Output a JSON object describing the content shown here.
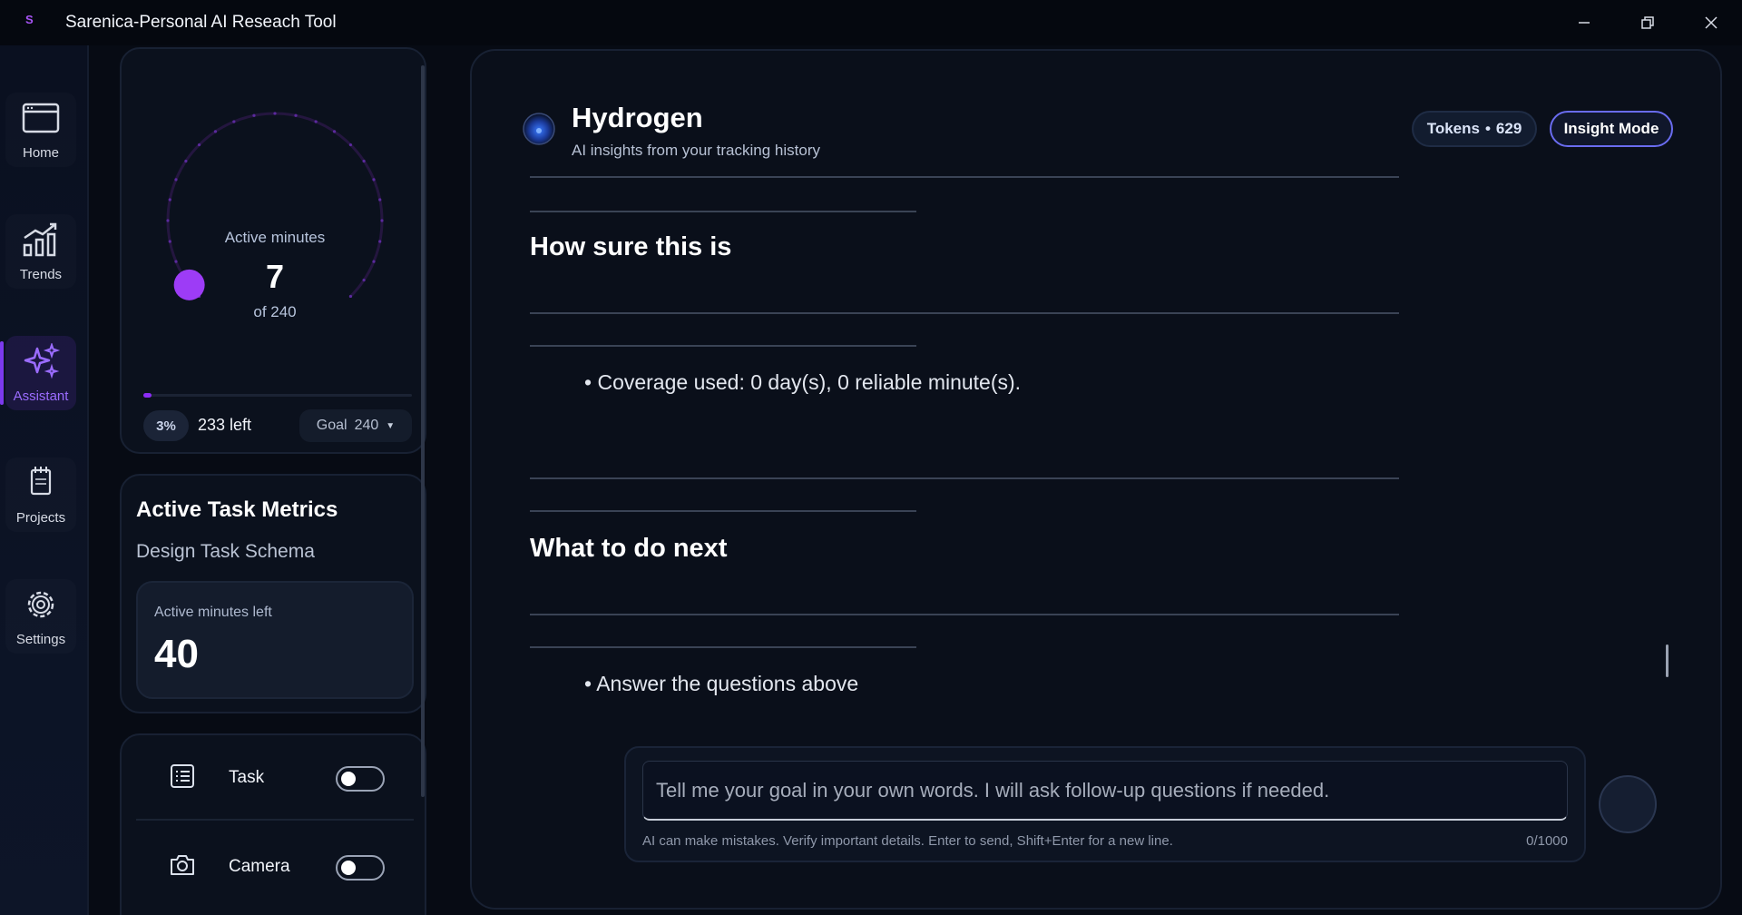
{
  "app": {
    "title": "Sarenica-Personal AI Reseach Tool",
    "logo": "S"
  },
  "colors": {
    "accent": "#8b2cf5",
    "active_nav": "#9b6cff",
    "insight_border": "#6a6cf0"
  },
  "nav": {
    "items": [
      {
        "label": "Home",
        "icon": "browser-window-icon",
        "active": false
      },
      {
        "label": "Trends",
        "icon": "bar-chart-trend-icon",
        "active": false
      },
      {
        "label": "Assistant",
        "icon": "sparkles-icon",
        "active": true
      },
      {
        "label": "Projects",
        "icon": "notebook-icon",
        "active": false
      },
      {
        "label": "Settings",
        "icon": "gear-icon",
        "active": false
      }
    ]
  },
  "gauge": {
    "caption": "Active minutes",
    "value": "7",
    "of_text": "of 240",
    "progress": 0.03,
    "percent": "3%",
    "left_text": "233 left",
    "goal_label": "Goal",
    "goal_value": "240"
  },
  "metrics": {
    "title": "Active Task Metrics",
    "task_name": "Design Task Schema",
    "minutes_left_caption": "Active minutes left",
    "minutes_left_value": "40"
  },
  "toggles": [
    {
      "label": "Task",
      "icon": "list-icon",
      "on": false
    },
    {
      "label": "Camera",
      "icon": "camera-icon",
      "on": false
    }
  ],
  "assistant": {
    "name": "Hydrogen",
    "subtitle": "AI insights from your tracking history",
    "tokens_label": "Tokens",
    "tokens_value": "629",
    "mode_button": "Insight Mode",
    "sections": [
      {
        "title": "How sure this is",
        "bullet": "Coverage used: 0 day(s), 0 reliable minute(s)."
      },
      {
        "title": "What to do next",
        "bullet": "Answer the questions above"
      }
    ]
  },
  "composer": {
    "placeholder": "Tell me your goal in your own words. I will ask follow-up questions if needed.",
    "note": "AI can make mistakes. Verify important details. Enter to send, Shift+Enter for a new line.",
    "counter": "0/1000"
  }
}
